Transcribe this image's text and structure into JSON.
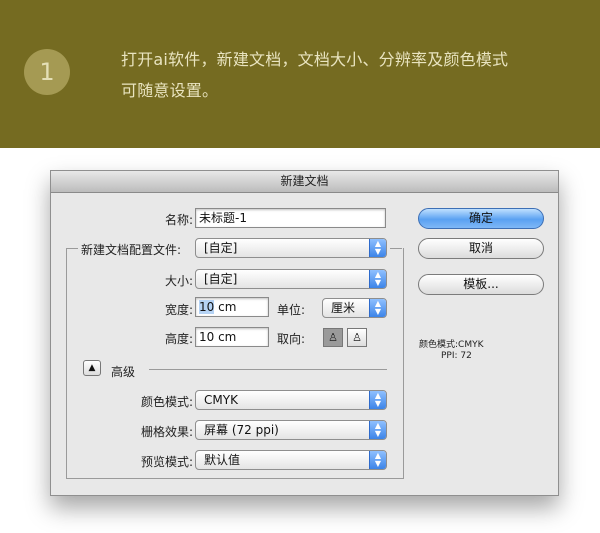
{
  "banner": {
    "step_number": "1",
    "line1": "打开ai软件，新建文档，文档大小、分辨率及颜色模式",
    "line2": "可随意设置。"
  },
  "dialog": {
    "title": "新建文档",
    "name_label": "名称:",
    "name_value": "未标题-1",
    "profile_label": "新建文档配置文件:",
    "profile_value": "[自定]",
    "size_label": "大小:",
    "size_value": "[自定]",
    "width_label": "宽度:",
    "width_value_num": "10",
    "width_value_unit": " cm",
    "units_label": "单位:",
    "units_value": "厘米",
    "height_label": "高度:",
    "height_value": "10 cm",
    "orientation_label": "取向:",
    "orientation_portrait_icon": "portrait-orientation-icon",
    "orientation_landscape_icon": "landscape-orientation-icon",
    "orientation_selected": "portrait",
    "advanced_label": "高级",
    "color_mode_label": "颜色模式:",
    "color_mode_value": "CMYK",
    "raster_label": "栅格效果:",
    "raster_value": "屏幕 (72 ppi)",
    "preview_label": "预览模式:",
    "preview_value": "默认值",
    "ok_button": "确定",
    "cancel_button": "取消",
    "templates_button": "模板...",
    "info_color_mode": "颜色模式:CMYK",
    "info_ppi": "PPI: 72"
  },
  "colors": {
    "banner_bg": "#756b21",
    "badge_bg": "#a59a53",
    "banner_text": "#e9e4c0",
    "accent_blue": "#5aa1f2"
  }
}
